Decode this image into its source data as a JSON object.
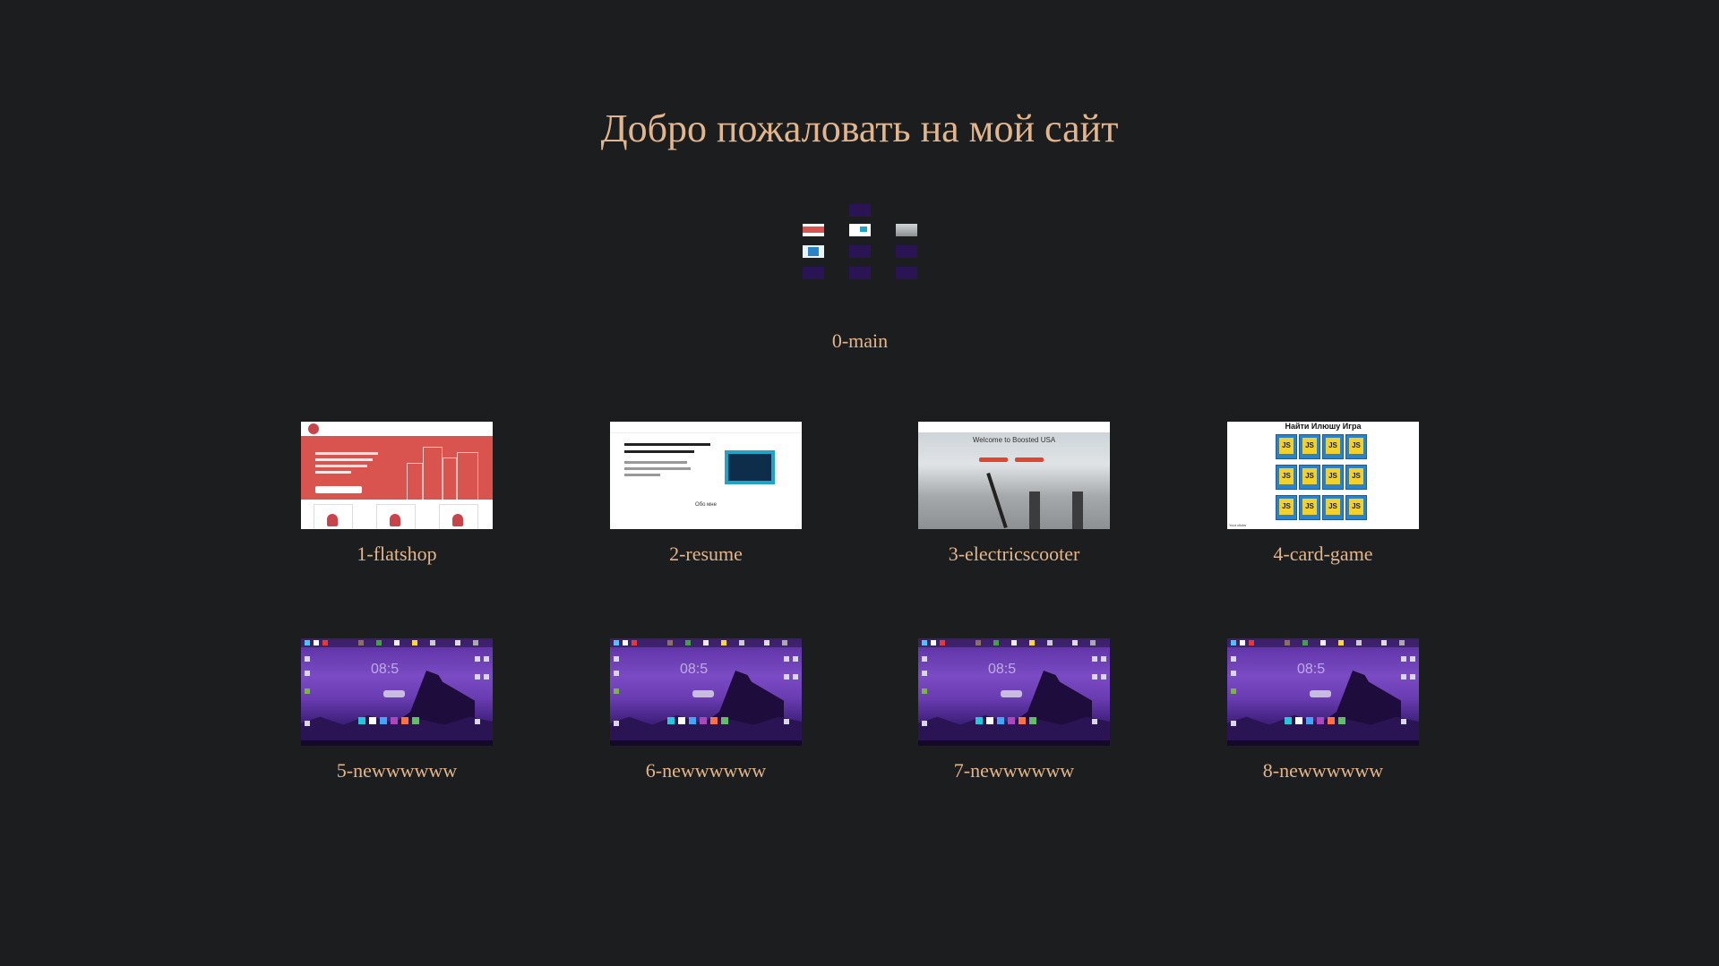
{
  "page": {
    "title": "Добро пожаловать на мой сайт"
  },
  "main_project": {
    "label": "0-main"
  },
  "projects": [
    {
      "label": "1-flatshop",
      "preview": "flatshop"
    },
    {
      "label": "2-resume",
      "preview": "resume"
    },
    {
      "label": "3-electricscooter",
      "preview": "scooter"
    },
    {
      "label": "4-card-game",
      "preview": "card-game"
    },
    {
      "label": "5-newwwwww",
      "preview": "desktop"
    },
    {
      "label": "6-newwwwww",
      "preview": "desktop"
    },
    {
      "label": "7-newwwwww",
      "preview": "desktop"
    },
    {
      "label": "8-newwwwww",
      "preview": "desktop"
    }
  ],
  "previews": {
    "resume_heading": "Обо мне",
    "scooter_heading": "Welcome to Boosted USA",
    "cardgame_heading": "Найти Илюшу Игра",
    "cardgame_card": "JS",
    "cardgame_footer": "Your clicks",
    "desktop_clock": "08:5"
  },
  "colors": {
    "background": "#1c1d1f",
    "accent_text": "#e2b58c"
  }
}
